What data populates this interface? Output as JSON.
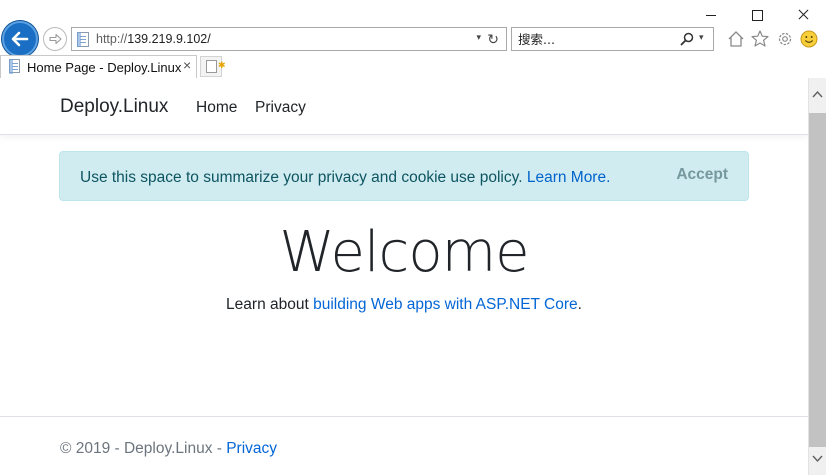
{
  "browser": {
    "url_protocol": "http://",
    "url_host": "139.219.9.102/",
    "search_placeholder": "搜索...",
    "tab_title": "Home Page - Deploy.Linux",
    "tab_close": "×",
    "addr_dropdown": "▾",
    "refresh": "↻",
    "search_dropdown": "▾",
    "icons": [
      "back-arrow-icon",
      "forward-arrow-icon",
      "page-icon",
      "refresh-icon",
      "search-icon",
      "home-icon",
      "star-icon",
      "gear-icon",
      "smiley-icon",
      "new-tab-icon"
    ]
  },
  "site": {
    "brand": "Deploy.Linux",
    "nav": {
      "home": "Home",
      "privacy": "Privacy"
    },
    "cookie": {
      "text": "Use this space to summarize your privacy and cookie use policy.",
      "link": "Learn More",
      "link_suffix": ".",
      "accept": "Accept"
    },
    "welcome": "Welcome",
    "lead": {
      "prefix": "Learn about",
      "link": "building Web apps with ASP.NET Core",
      "suffix": "."
    },
    "footer": {
      "text": "© 2019 - Deploy.Linux - ",
      "link": "Privacy"
    }
  },
  "colors": {
    "brand_blue": "#1a6fc4",
    "link": "#0366d6",
    "alert_bg": "#d1ecf1",
    "alert_text": "#0c5460"
  }
}
